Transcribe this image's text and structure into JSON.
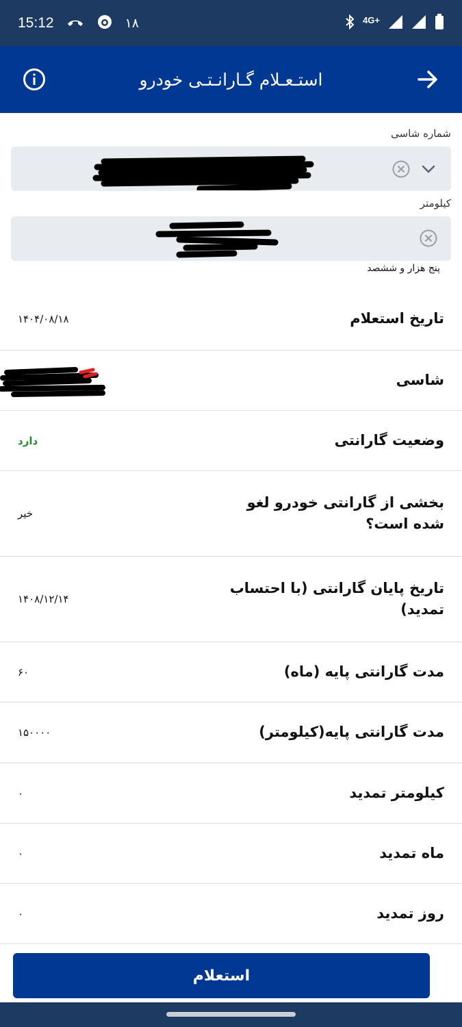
{
  "status_bar": {
    "time": "15:12",
    "notification_count": "۱۸",
    "network": "4G+"
  },
  "app_bar": {
    "title": "استـعـلام گـارانـتـی خودرو"
  },
  "form": {
    "chassis_label": "شماره شاسی",
    "km_label": "کیلومتر",
    "km_words": "پنج هزار و ششصد"
  },
  "rows": [
    {
      "label": "تاریخ استعلام",
      "value": "۱۴۰۴/۰۸/۱۸"
    },
    {
      "label": "شاسی",
      "value": ""
    },
    {
      "label": "وضعیت گارانتی",
      "value": "دارد"
    },
    {
      "label": "بخشی از گارانتی خودرو لغو شده است؟",
      "value": "خیر"
    },
    {
      "label": "تاریخ پایان گارانتی (با احتساب تمدید)",
      "value": "۱۴۰۸/۱۲/۱۴"
    },
    {
      "label": "مدت گارانتی پایه (ماه)",
      "value": "۶۰"
    },
    {
      "label": "مدت گارانتی پایه(کیلومتر)",
      "value": "۱۵۰۰۰۰"
    },
    {
      "label": "کیلومتر تمدید",
      "value": "۰"
    },
    {
      "label": "ماه تمدید",
      "value": "۰"
    },
    {
      "label": "روز تمدید",
      "value": "۰"
    }
  ],
  "submit_label": "استعلام",
  "colors": {
    "primary": "#003893",
    "status_bar": "#1d3a62",
    "field_bg": "#e8ecf1",
    "success": "#1e8c2e"
  }
}
